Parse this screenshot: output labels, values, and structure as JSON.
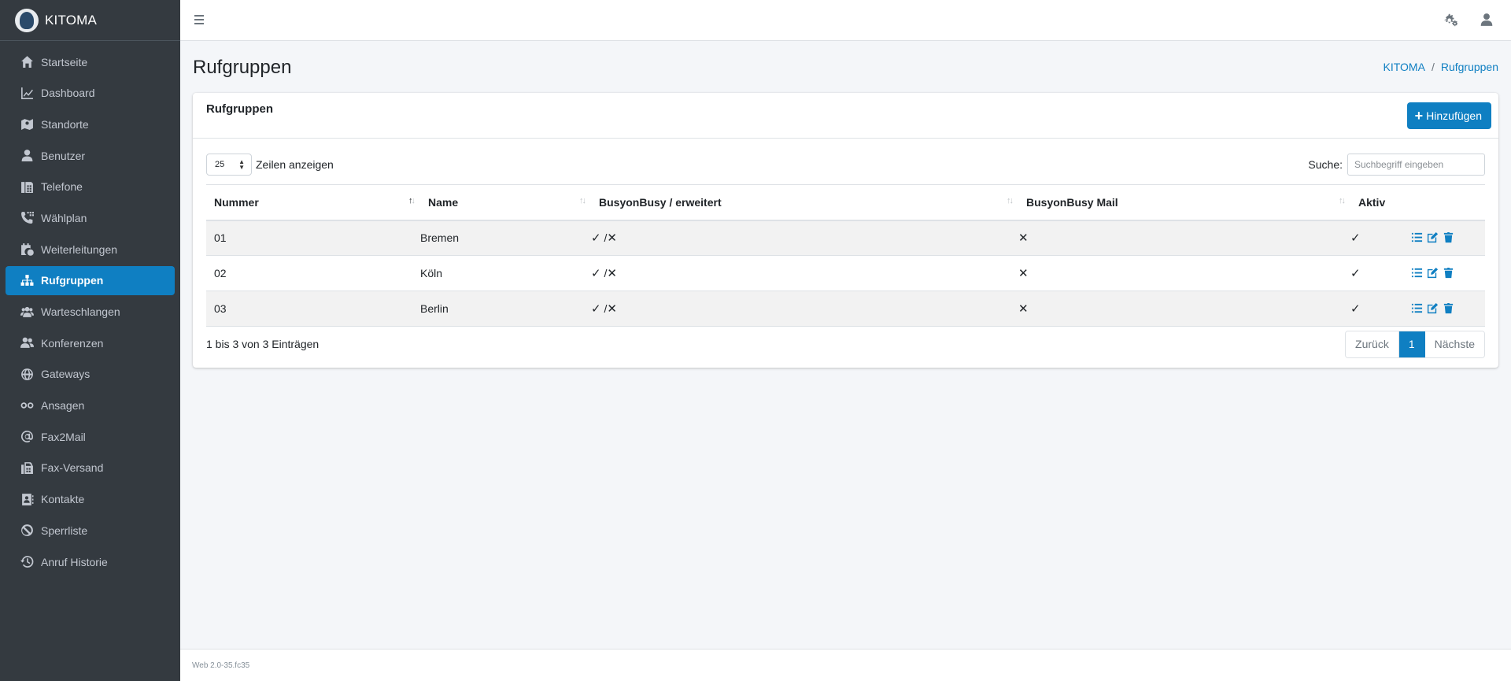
{
  "app": {
    "brand_name": "KITOMA",
    "version": "Web 2.0-35.fc35"
  },
  "sidebar": {
    "items": [
      {
        "label": "Startseite",
        "icon": "home-icon"
      },
      {
        "label": "Dashboard",
        "icon": "chart-line-icon"
      },
      {
        "label": "Standorte",
        "icon": "map-icon"
      },
      {
        "label": "Benutzer",
        "icon": "user-icon"
      },
      {
        "label": "Telefone",
        "icon": "fax-phone-icon"
      },
      {
        "label": "Wählplan",
        "icon": "phone-keypad-icon"
      },
      {
        "label": "Weiterleitungen",
        "icon": "calendar-clock-icon"
      },
      {
        "label": "Rufgruppen",
        "icon": "sitemap-icon",
        "active": true
      },
      {
        "label": "Warteschlangen",
        "icon": "users-icon"
      },
      {
        "label": "Konferenzen",
        "icon": "user-friends-icon"
      },
      {
        "label": "Gateways",
        "icon": "globe-icon"
      },
      {
        "label": "Ansagen",
        "icon": "voicemail-icon"
      },
      {
        "label": "Fax2Mail",
        "icon": "at-icon"
      },
      {
        "label": "Fax-Versand",
        "icon": "fax-icon"
      },
      {
        "label": "Kontakte",
        "icon": "address-book-icon"
      },
      {
        "label": "Sperrliste",
        "icon": "ban-icon"
      },
      {
        "label": "Anruf Historie",
        "icon": "history-icon"
      }
    ]
  },
  "header": {
    "page_title": "Rufgruppen",
    "breadcrumb": [
      "KITOMA",
      "Rufgruppen"
    ],
    "separator": "/"
  },
  "card": {
    "title": "Rufgruppen",
    "add_label": "Hinzufügen",
    "length_value": "25",
    "length_label": "Zeilen anzeigen",
    "search_label": "Suche:",
    "search_placeholder": "Suchbegriff eingeben"
  },
  "table": {
    "columns": [
      "Nummer",
      "Name",
      "BusyonBusy / erweitert",
      "BusyonBusy Mail",
      "Aktiv"
    ],
    "rows": [
      {
        "nummer": "01",
        "name": "Bremen",
        "busy_sep": "/",
        "mail": "✕",
        "aktiv": "✓"
      },
      {
        "nummer": "02",
        "name": "Köln",
        "busy_sep": "/",
        "mail": "✕",
        "aktiv": "✓"
      },
      {
        "nummer": "03",
        "name": "Berlin",
        "busy_sep": "/",
        "mail": "✕",
        "aktiv": "✓"
      }
    ],
    "info": "1 bis 3 von 3 Einträgen"
  },
  "pagination": {
    "prev": "Zurück",
    "current": "1",
    "next": "Nächste"
  },
  "colors": {
    "sidebar_bg": "#343a40",
    "accent": "#0f7fc2",
    "page_bg": "#f4f6f9"
  }
}
